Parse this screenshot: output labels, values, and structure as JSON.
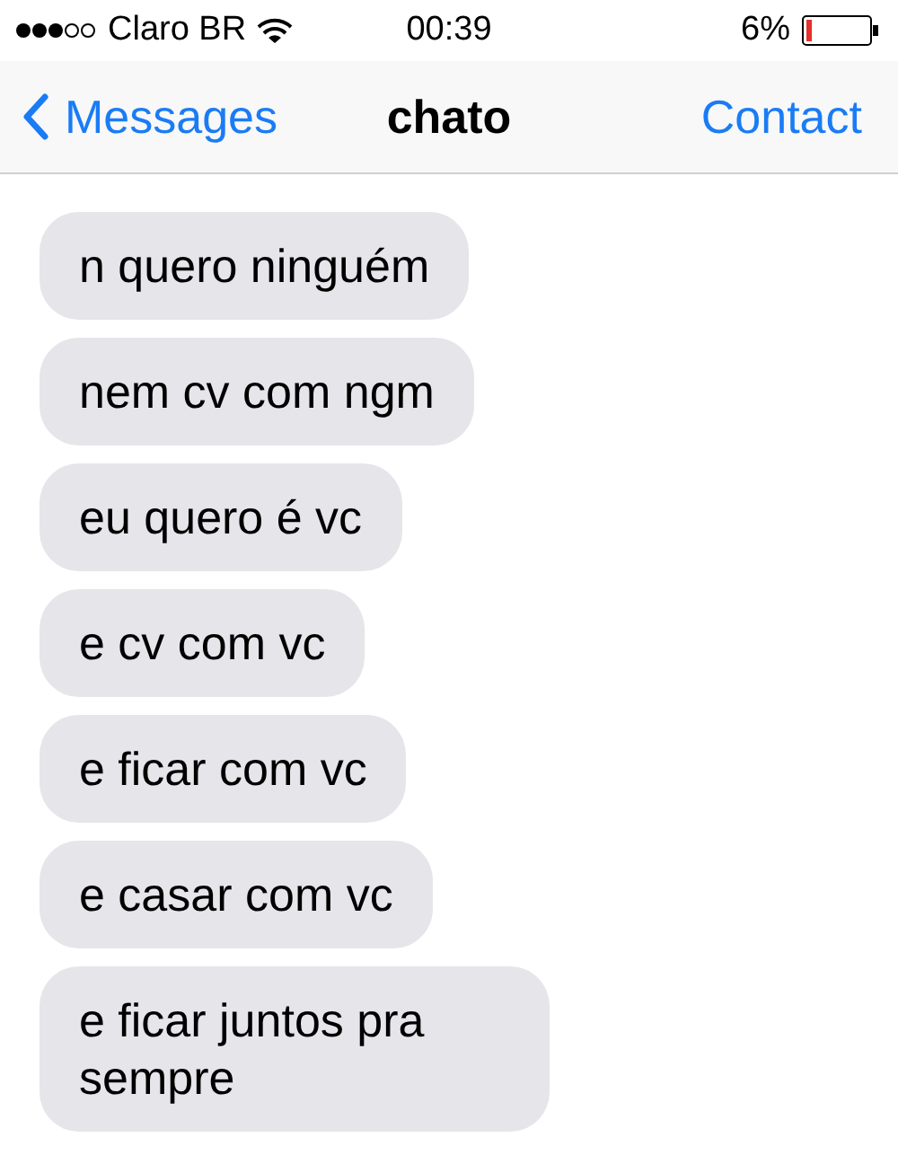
{
  "status_bar": {
    "carrier": "Claro BR",
    "time": "00:39",
    "battery": "6%"
  },
  "nav": {
    "back": "Messages",
    "title": "chato",
    "action": "Contact"
  },
  "messages": [
    {
      "text": "n quero ninguém"
    },
    {
      "text": "nem cv com ngm"
    },
    {
      "text": "eu quero é vc"
    },
    {
      "text": "e cv com vc"
    },
    {
      "text": "e ficar com vc"
    },
    {
      "text": "e casar com vc"
    },
    {
      "text": "e ficar juntos pra sempre"
    }
  ]
}
